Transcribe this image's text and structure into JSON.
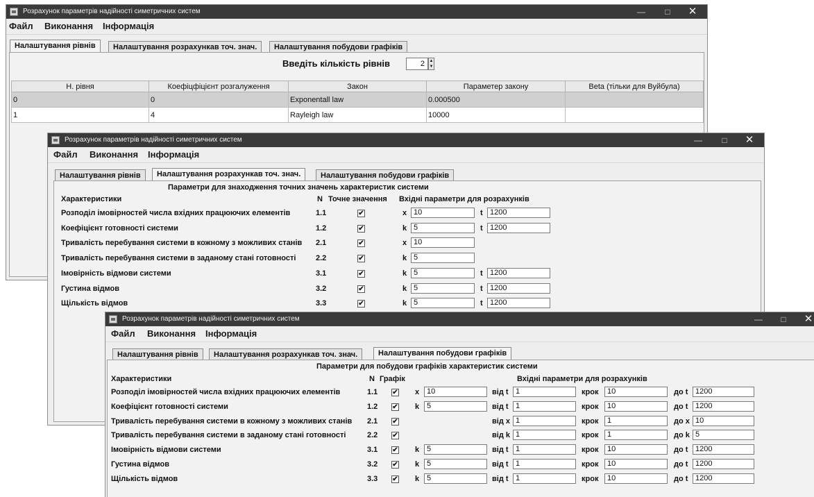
{
  "app_title": "Розрахунок параметрів надійності симетричних систем",
  "window_controls": {
    "minimize": "—",
    "maximize": "□",
    "close": "✕"
  },
  "menu": [
    "Файл",
    "Виконання",
    "Інформація"
  ],
  "tabs": [
    "Налаштування рівнів",
    "Налаштування розрахункав точ. знач.",
    "Налаштування побудови графіків"
  ],
  "levels": {
    "prompt": "Введіть кількість рівнів",
    "count": "2",
    "columns": [
      "Н. рівня",
      "Коефіцфіцієнт розгалуження",
      "Закон",
      "Параметер закону",
      "Beta (тільки для Вуйбула)"
    ],
    "rows": [
      [
        "0",
        "0",
        "Exponentall law",
        "0.000500",
        ""
      ],
      [
        "1",
        "4",
        "Rayleigh law",
        "10000",
        ""
      ]
    ]
  },
  "exact": {
    "heading": "Параметри для знаходження точних значень характеристик системи",
    "col_char": "Характеристики",
    "col_n": "N",
    "col_exact": "Точне значення",
    "col_params": "Вхідні параметри для розрахунків",
    "rows": [
      {
        "name": "Розподіл імовірностей числа вхідних працюючих елементів",
        "n": "1.1",
        "checked": "✔",
        "p1": "x",
        "v1": "10",
        "p2": "t",
        "v2": "1200"
      },
      {
        "name": "Коефіцієнт готовності системи",
        "n": "1.2",
        "checked": "✔",
        "p1": "k",
        "v1": "5",
        "p2": "t",
        "v2": "1200"
      },
      {
        "name": "Тривалість перебування системи в кожному з можливих станів",
        "n": "2.1",
        "checked": "✔",
        "p1": "x",
        "v1": "10",
        "p2": "",
        "v2": ""
      },
      {
        "name": "Тривалість перебування системи в заданому стані готовності",
        "n": "2.2",
        "checked": "✔",
        "p1": "k",
        "v1": "5",
        "p2": "",
        "v2": ""
      },
      {
        "name": "Імовірність відмови системи",
        "n": "3.1",
        "checked": "✔",
        "p1": "k",
        "v1": "5",
        "p2": "t",
        "v2": "1200"
      },
      {
        "name": "Густина відмов",
        "n": "3.2",
        "checked": "✔",
        "p1": "k",
        "v1": "5",
        "p2": "t",
        "v2": "1200"
      },
      {
        "name": "Щількість відмов",
        "n": "3.3",
        "checked": "✔",
        "p1": "k",
        "v1": "5",
        "p2": "t",
        "v2": "1200"
      }
    ]
  },
  "graphs": {
    "heading": "Параметри для побудови графіків характеристик системи",
    "col_char": "Характеристики",
    "col_n": "N",
    "col_graph": "Графік",
    "col_params": "Вхідні параметри для розрахунків",
    "rows": [
      {
        "name": "Розподіл імовірностей числа вхідних працюючих елементів",
        "n": "1.1",
        "checked": "✔",
        "p": "x",
        "v": "10",
        "from_l": "від t",
        "from": "1",
        "step_l": "крок",
        "step": "10",
        "to_l": "до t",
        "to": "1200"
      },
      {
        "name": "Коефіцієнт готовності системи",
        "n": "1.2",
        "checked": "✔",
        "p": "k",
        "v": "5",
        "from_l": "від t",
        "from": "1",
        "step_l": "крок",
        "step": "10",
        "to_l": "до t",
        "to": "1200"
      },
      {
        "name": "Тривалість перебування системи в кожному з можливих станів",
        "n": "2.1",
        "checked": "✔",
        "p": "",
        "v": "",
        "from_l": "від x",
        "from": "1",
        "step_l": "крок",
        "step": "1",
        "to_l": "до x",
        "to": "10"
      },
      {
        "name": "Тривалість перебування системи в заданому стані готовності",
        "n": "2.2",
        "checked": "✔",
        "p": "",
        "v": "",
        "from_l": "від k",
        "from": "1",
        "step_l": "крок",
        "step": "1",
        "to_l": "до k",
        "to": "5"
      },
      {
        "name": "Імовірність відмови системи",
        "n": "3.1",
        "checked": "✔",
        "p": "k",
        "v": "5",
        "from_l": "від t",
        "from": "1",
        "step_l": "крок",
        "step": "10",
        "to_l": "до t",
        "to": "1200"
      },
      {
        "name": "Густина відмов",
        "n": "3.2",
        "checked": "✔",
        "p": "k",
        "v": "5",
        "from_l": "від t",
        "from": "1",
        "step_l": "крок",
        "step": "10",
        "to_l": "до t",
        "to": "1200"
      },
      {
        "name": "Щількість відмов",
        "n": "3.3",
        "checked": "✔",
        "p": "k",
        "v": "5",
        "from_l": "від t",
        "from": "1",
        "step_l": "крок",
        "step": "10",
        "to_l": "до t",
        "to": "1200"
      }
    ]
  }
}
